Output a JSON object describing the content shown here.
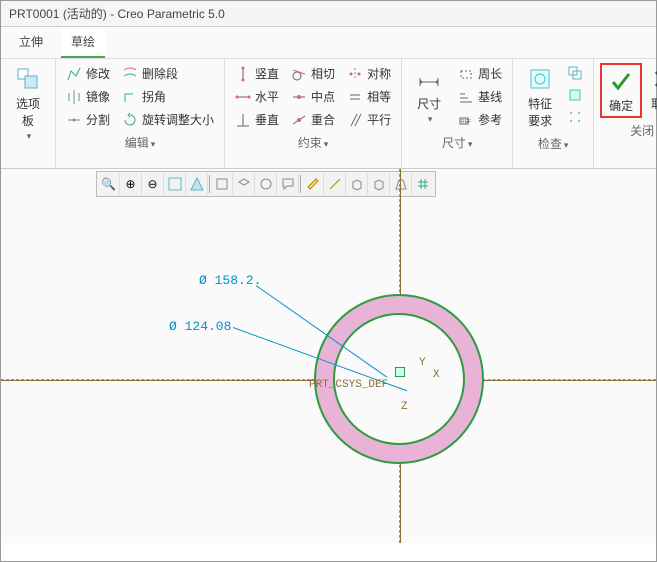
{
  "window": {
    "title": "PRT0001 (活动的) - Creo Parametric 5.0"
  },
  "tabs": {
    "t1": "立伸",
    "t2": "草绘"
  },
  "group_labels": {
    "options": "选项板",
    "edit": "编辑",
    "constrain": "约束",
    "dim": "尺寸",
    "inspect": "检查",
    "close": "关闭"
  },
  "btn": {
    "options": "选项板",
    "modify": "修改",
    "delseg": "删除段",
    "mirror": "镜像",
    "corner": "拐角",
    "split": "分割",
    "rotresize": "旋转调整大小",
    "vert": "竖直",
    "tangent": "相切",
    "symm": "对称",
    "horiz": "水平",
    "mid": "中点",
    "equal": "相等",
    "perp": "垂直",
    "coinc": "重合",
    "para": "平行",
    "dim": "尺寸",
    "perim": "周长",
    "baseline": "基线",
    "ref": "参考",
    "featreq": "特征要求",
    "confirm": "确定",
    "cancel": "取消"
  },
  "dropdown_marker": "▾",
  "sketch": {
    "dim1": "Ø 158.2.",
    "dim2": "Ø 124.08",
    "csys": "PRT_CSYS_DEF",
    "axis_x": "X",
    "axis_y": "Y",
    "axis_z": "Z"
  },
  "icons": {
    "zoom": "🔍",
    "zoomin": "⊕",
    "zoomout": "⊖"
  },
  "chart_data": {
    "type": "diagram",
    "note": "CAD sketch: two concentric circles (OD≈158.2, ID≈124.08) centered at PRT_CSYS_DEF origin with horizontal/vertical datum axes."
  }
}
